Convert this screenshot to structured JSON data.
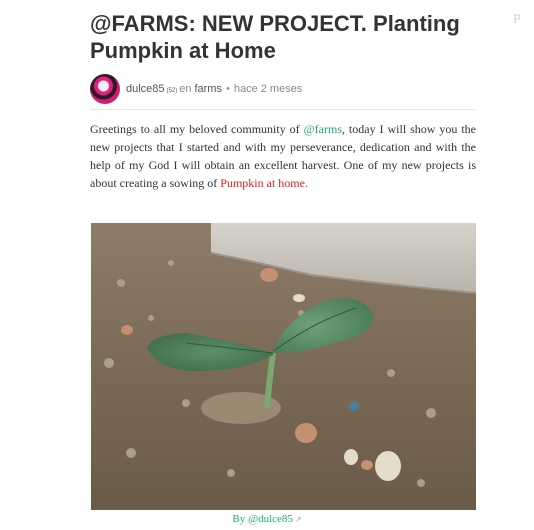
{
  "post": {
    "title": "@FARMS: NEW PROJECT. Planting Pumpkin at Home"
  },
  "author": {
    "name": "dulce85",
    "reputation": "(52)",
    "community_prefix": "en",
    "community": "farms",
    "separator": "•",
    "time_ago": "hace 2 meses"
  },
  "body": {
    "p1_part1": "Greetings to all my beloved community of ",
    "mention": "@farms",
    "p1_part2": ", today I will show you the new projects that I started and with my perseverance, dedication and with the help of my God I will obtain an excellent harvest. One of my new projects is about creating a sowing of ",
    "highlight": "Pumpkin at home."
  },
  "image": {
    "description_icon": "pumpkin-seedling-photo",
    "caption": "By @dulce85",
    "caption_icon": "external-link-icon"
  },
  "icons": {
    "flag": "flag-icon"
  },
  "colors": {
    "accent_green": "#1ab06d",
    "highlight_red": "#e0201b",
    "title": "#333333"
  }
}
